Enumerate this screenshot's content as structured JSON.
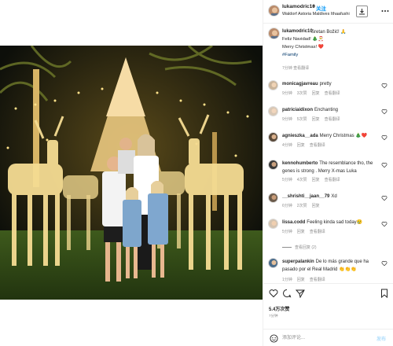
{
  "colors": {
    "accent": "#0095f6",
    "muted": "#8e8e8e",
    "text": "#262626",
    "tag": "#00376b",
    "border": "#efefef"
  },
  "header": {
    "username": "lukamodric10",
    "separator": "•",
    "follow_label": "关注",
    "location": "Waldorf Astoria Maldives Ithaafushi",
    "save_icon": "download-icon",
    "more_icon": "more-horizontal-icon"
  },
  "caption": {
    "username": "lukamodric10",
    "line1": "Sretan Božić! 🙏",
    "line2": "Feliz Navidad! 🎄🎅",
    "line3": "Merry Christmas! ❤️",
    "hashtag": "#Family",
    "time": "7分钟  查看翻译"
  },
  "comments": [
    {
      "username": "monicagjavreau",
      "text": "pretty",
      "meta": [
        "9分钟",
        "3次赞",
        "回复",
        "查看翻译"
      ]
    },
    {
      "username": "patriciaidixon",
      "text": "Enchanting",
      "meta": [
        "9分钟",
        "5次赞",
        "回复",
        "查看翻译"
      ]
    },
    {
      "username": "agnieszka__ada",
      "text": "Merry Christmas 🎄❤️",
      "meta": [
        "4分钟",
        "回复",
        "查看翻译"
      ]
    },
    {
      "username": "kennohumberto",
      "text": "The resemblance tho, the genes is strong . Merry X-mas Luka",
      "meta": [
        "5分钟",
        "4次赞",
        "回复",
        "查看翻译"
      ]
    },
    {
      "username": "__shrishti__jaan__79",
      "text": "Xd",
      "meta": [
        "6分钟",
        "2次赞",
        "回复"
      ]
    },
    {
      "username": "lissa.codd",
      "text": "Feeling kinda sad today😢",
      "meta": [
        "5分钟",
        "回复",
        "查看翻译"
      ]
    },
    {
      "username": "superpalankin",
      "text": "De lo más grande que ha pasado por el Real Madrid 👏👏👏",
      "meta": [
        "1分钟",
        "回复",
        "查看翻译"
      ]
    }
  ],
  "view_replies": "查看回复 (2)",
  "actions": {
    "like_icon": "heart-icon",
    "comment_icon": "comment-icon",
    "share_icon": "share-icon",
    "save_icon": "bookmark-icon",
    "likes": "5.4万次赞",
    "time": "7分钟"
  },
  "add_comment": {
    "placeholder": "添加评论...",
    "post_label": "发布",
    "emoji_icon": "emoji-icon"
  }
}
